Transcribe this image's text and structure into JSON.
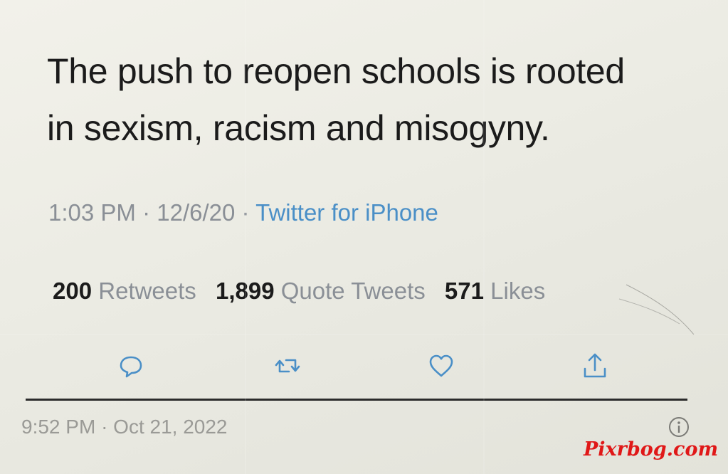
{
  "tweet": {
    "text_line_1": "The push to reopen schools is rooted",
    "text_line_2": "in sexism, racism and misogyny.",
    "time": "1:03 PM",
    "date": "12/6/20",
    "separator": "·",
    "source": "Twitter for iPhone"
  },
  "stats": {
    "retweets_count": "200",
    "retweets_label": "Retweets",
    "quotes_count": "1,899",
    "quotes_label": "Quote Tweets",
    "likes_count": "571",
    "likes_label": "Likes"
  },
  "actions": [
    {
      "icon": "reply-icon"
    },
    {
      "icon": "retweet-icon"
    },
    {
      "icon": "like-icon"
    },
    {
      "icon": "share-icon"
    }
  ],
  "status_bar": {
    "time": "9:52 PM",
    "separator": "·",
    "date": "Oct 21, 2022",
    "info_icon": "info-icon"
  },
  "watermark": {
    "text": "Pixrbog.com"
  },
  "colors": {
    "link": "#4a8fc7",
    "meta": "#8a8f96",
    "icon": "#4a8fc7",
    "watermark": "#e01818"
  }
}
